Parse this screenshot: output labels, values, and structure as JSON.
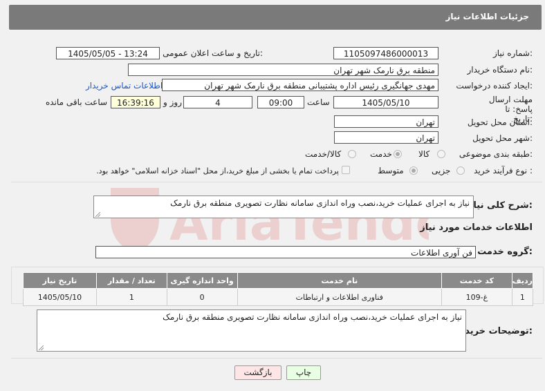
{
  "header": {
    "title": "جزئیات اطلاعات نیاز"
  },
  "form": {
    "need_number_label": "شماره نیاز:",
    "need_number": "1105097486000013",
    "announce_label": "تاریخ و ساعت اعلان عمومی:",
    "announce_value": "1405/05/05 - 13:24",
    "buyer_org_label": "نام دستگاه خریدار:",
    "buyer_org": "منطقه برق نارمک شهر تهران",
    "creator_label": "ایجاد کننده درخواست:",
    "creator": "مهدی جهانگیری رئیس اداره پشتیبانی  منطقه برق نارمک شهر تهران",
    "contact_link": "اطلاعات تماس خریدار",
    "deadline_label": "مهلت ارسال پاسخ: تا تاریخ:",
    "deadline_date": "1405/05/10",
    "time_label": "ساعت",
    "deadline_time": "09:00",
    "days_value": "4",
    "days_label": "روز و",
    "remaining_time": "16:39:16",
    "remaining_label": "ساعت باقی مانده",
    "province_label": "استان محل تحویل:",
    "province": "تهران",
    "city_label": "شهر محل تحویل:",
    "city": "تهران",
    "category_label": "طبقه بندی موضوعی:",
    "category_options": [
      "کالا",
      "خدمت",
      "کالا/خدمت"
    ],
    "process_label": "نوع فرآیند خرید :",
    "process_options": [
      "جزیی",
      "متوسط"
    ],
    "payment_note": "پرداخت تمام یا بخشی از مبلغ خرید،از محل \"اسناد خزانه اسلامی\" خواهد بود."
  },
  "description": {
    "label": "شرح کلی نیاز:",
    "text": "نیاز به اجرای عملیات خرید،نصب وراه اندازی سامانه نظارت تصویری منطقه برق نارمک"
  },
  "services": {
    "section_title": "اطلاعات خدمات مورد نیاز",
    "group_label": "گروه خدمت:",
    "group_value": "فن آوری اطلاعات",
    "table": {
      "headers": [
        "ردیف",
        "کد خدمت",
        "نام خدمت",
        "واحد اندازه گیری",
        "تعداد / مقدار",
        "تاریخ نیاز"
      ],
      "rows": [
        [
          "1",
          "غ-109",
          "فناوری اطلاعات و ارتباطات",
          "0",
          "1",
          "1405/05/10"
        ]
      ]
    }
  },
  "buyer_notes": {
    "label": "توضیحات خریدار:",
    "text": "نیاز به اجرای عملیات خرید،نصب وراه اندازی سامانه نظارت تصویری منطقه برق نارمک"
  },
  "buttons": {
    "print": "چاپ",
    "back": "بازگشت"
  },
  "watermark": {
    "text": "AriaTender.net"
  },
  "colors": {
    "header_bg": "#7a7a7a",
    "link": "#1a56c7",
    "print_bg": "#e9ffe3",
    "back_bg": "#ffe6e6"
  }
}
